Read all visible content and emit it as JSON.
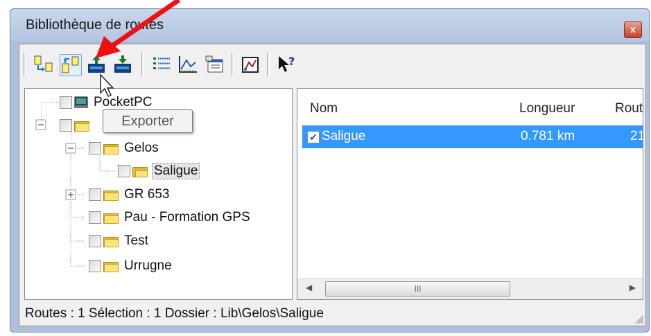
{
  "window": {
    "title": "Bibliothèque de routes",
    "close_label": "x"
  },
  "toolbar": {
    "buttons": [
      "import-icon",
      "export-icon",
      "upload-device-icon",
      "download-device-icon",
      "list-icon",
      "profile-icon",
      "properties-icon",
      "map-icon",
      "help-icon"
    ]
  },
  "tooltip": {
    "text": "Exporter"
  },
  "tree": {
    "items": [
      {
        "label": "PocketPC"
      },
      {
        "label": ""
      },
      {
        "label": "Gelos"
      },
      {
        "label": "Saligue"
      },
      {
        "label": "GR 653"
      },
      {
        "label": "Pau - Formation GPS"
      },
      {
        "label": "Test"
      },
      {
        "label": "Urrugne"
      }
    ]
  },
  "list": {
    "columns": [
      "Nom",
      "Longueur",
      "Rout"
    ],
    "rows": [
      {
        "name": "Saligue",
        "length": "0.781 km",
        "route": "21"
      }
    ],
    "scroll_thumb_label": "III"
  },
  "status": {
    "text": "Routes : 1 Sélection : 1 Dossier : Lib\\Gelos\\Saligue"
  },
  "colors": {
    "selection": "#3399ff",
    "arrow": "#ee1111",
    "folder": "#fbe47a"
  }
}
